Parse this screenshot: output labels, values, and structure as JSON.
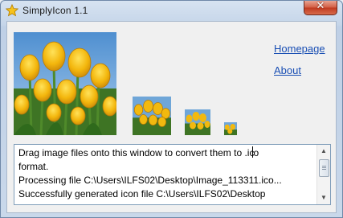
{
  "window": {
    "title": "SimplyIcon 1.1",
    "app_icon": "star-icon",
    "close_label": "✕"
  },
  "links": {
    "homepage": "Homepage",
    "about": "About"
  },
  "thumbnails": [
    {
      "name": "tulips-preview-large",
      "icon": "tulip-image"
    },
    {
      "name": "tulips-preview-48",
      "icon": "tulip-image"
    },
    {
      "name": "tulips-preview-32",
      "icon": "tulip-image"
    },
    {
      "name": "tulips-preview-16",
      "icon": "tulip-image"
    }
  ],
  "log": {
    "line1_a": "Drag image files onto this window to convert them to .ic",
    "line1_b": "o",
    "line2": "format.",
    "line3": "Processing file C:\\Users\\ILFS02\\Desktop\\Image_113311.ico...",
    "line4": "Successfully generated icon file C:\\Users\\ILFS02\\Desktop"
  },
  "colors": {
    "link": "#1a4fb4",
    "sky": "#6fa6d8",
    "tulip": "#f2b90f",
    "stem": "#4f8a2a"
  }
}
